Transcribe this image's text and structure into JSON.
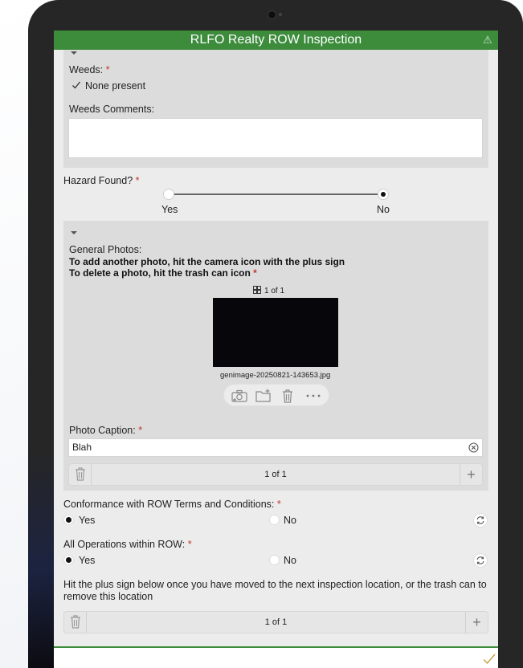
{
  "app": {
    "title": "RLFO Realty ROW Inspection"
  },
  "weeds": {
    "label": "Weeds:",
    "required": "*",
    "checkbox_label": "None present",
    "comments_label": "Weeds Comments:",
    "comments_value": ""
  },
  "hazard": {
    "label": "Hazard Found?",
    "required": "*",
    "options": [
      "Yes",
      "No"
    ],
    "selected": "No"
  },
  "photos": {
    "label": "General Photos:",
    "instruction_1": "To add another photo, hit the camera icon with the plus sign",
    "instruction_2": "To delete a photo, hit the trash can icon",
    "required": "*",
    "counter": "1 of 1",
    "filename": "genimage-20250821-143653.jpg",
    "caption_label": "Photo Caption:",
    "caption_required": "*",
    "caption_value": "Blah",
    "pager_count": "1 of 1"
  },
  "conformance": {
    "label": "Conformance with ROW Terms and Conditions:",
    "required": "*",
    "options": [
      "Yes",
      "No"
    ],
    "selected": "Yes"
  },
  "operations": {
    "label": "All Operations within ROW:",
    "required": "*",
    "options": [
      "Yes",
      "No"
    ],
    "selected": "Yes"
  },
  "location": {
    "instruction": "Hit the plus sign below once you have moved to the next inspection location, or the trash can to remove this location",
    "pager_count": "1 of 1"
  },
  "colors": {
    "accent": "#3c8c3c",
    "required": "#c0392b"
  }
}
